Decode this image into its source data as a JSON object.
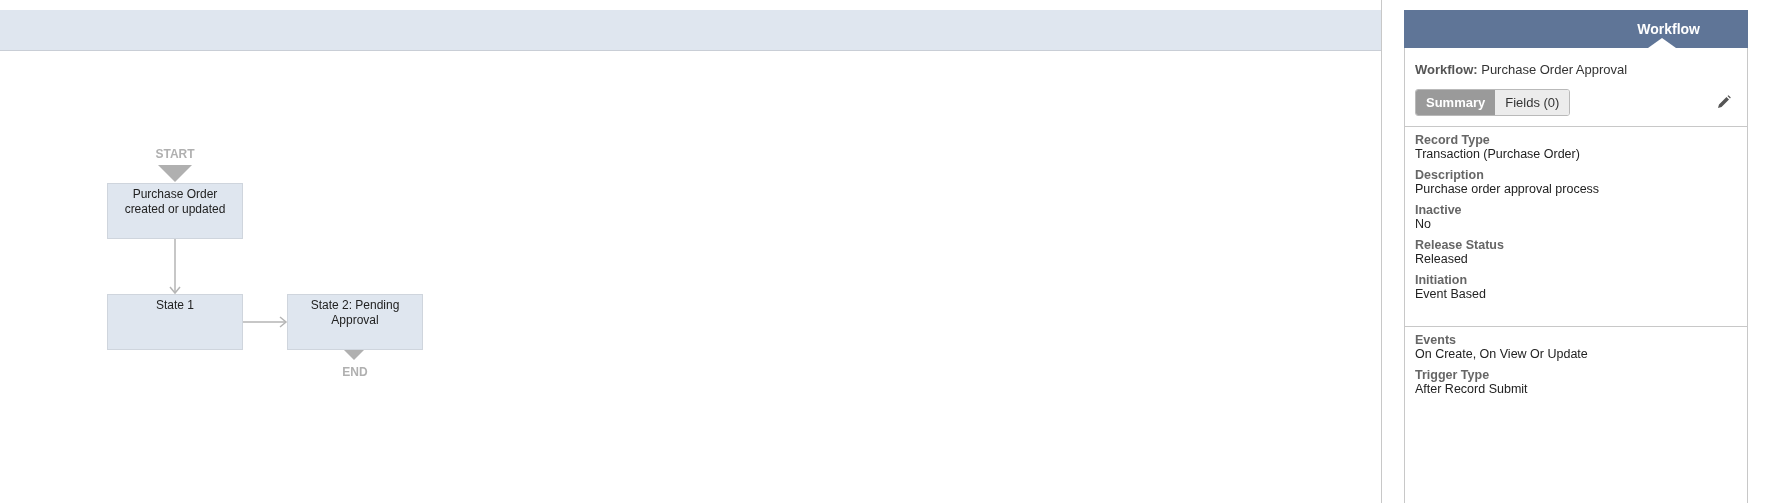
{
  "diagram": {
    "start_label": "START",
    "end_label": "END",
    "nodes": [
      {
        "text": "Purchase Order created or updated"
      },
      {
        "text": "State 1"
      },
      {
        "text": "State 2: Pending Approval"
      }
    ]
  },
  "panel": {
    "header": "Workflow",
    "title_label": "Workflow:",
    "title_value": "Purchase Order Approval",
    "tabs": [
      {
        "label": "Summary",
        "selected": true
      },
      {
        "label": "Fields (0)",
        "selected": false
      }
    ],
    "sections": [
      [
        {
          "label": "Record Type",
          "value": "Transaction (Purchase Order)"
        },
        {
          "label": "Description",
          "value": "Purchase order approval process"
        },
        {
          "label": "Inactive",
          "value": "No"
        },
        {
          "label": "Release Status",
          "value": "Released"
        },
        {
          "label": "Initiation",
          "value": "Event Based"
        }
      ],
      [
        {
          "label": "Events",
          "value": "On Create, On View Or Update"
        },
        {
          "label": "Trigger Type",
          "value": "After Record Submit"
        }
      ]
    ]
  }
}
